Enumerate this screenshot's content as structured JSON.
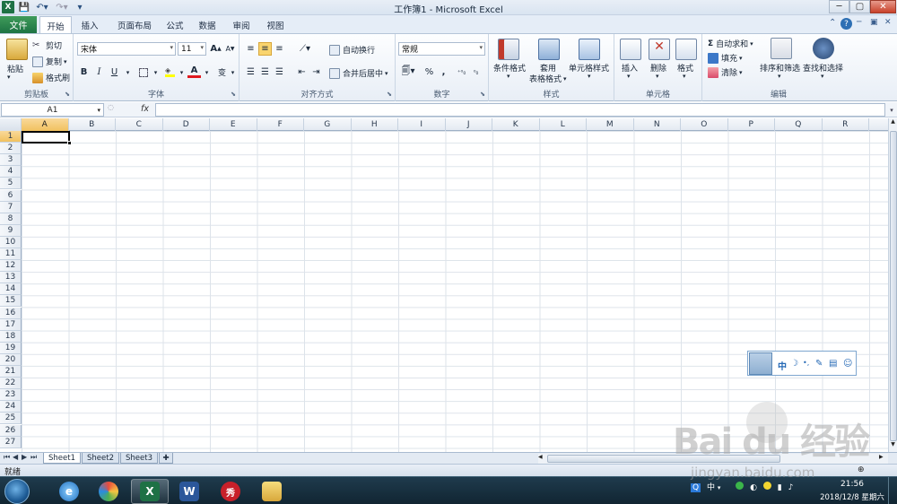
{
  "app": {
    "title": "工作簿1 - Microsoft Excel"
  },
  "tabs": [
    "文件",
    "开始",
    "插入",
    "页面布局",
    "公式",
    "数据",
    "审阅",
    "视图"
  ],
  "clipboard": {
    "paste": "粘贴",
    "cut": "剪切",
    "copy": "复制",
    "format_painter": "格式刷",
    "label": "剪贴板"
  },
  "font": {
    "name": "宋体",
    "size": "11",
    "bold": "B",
    "italic": "I",
    "underline": "U",
    "grow": "A",
    "shrink": "A",
    "font_color": "A",
    "phonetic": "变",
    "label": "字体"
  },
  "alignment": {
    "wrap": "自动换行",
    "merge": "合并后居中",
    "label": "对齐方式"
  },
  "number": {
    "format": "常规",
    "percent": "%",
    "comma": ",",
    "label": "数字"
  },
  "styles": {
    "conditional": "条件格式",
    "table_line1": "套用",
    "table_line2": "表格格式",
    "cell_styles": "单元格样式",
    "label": "样式"
  },
  "cells": {
    "insert": "插入",
    "delete": "删除",
    "format": "格式",
    "label": "单元格"
  },
  "editing": {
    "autosum": "自动求和",
    "fill": "填充",
    "clear": "清除",
    "sort": "排序和筛选",
    "find": "查找和选择",
    "label": "编辑"
  },
  "formula": {
    "namebox": "A1",
    "fx": "fx",
    "value": ""
  },
  "columns": [
    "A",
    "B",
    "C",
    "D",
    "E",
    "F",
    "G",
    "H",
    "I",
    "J",
    "K",
    "L",
    "M",
    "N",
    "O",
    "P",
    "Q",
    "R"
  ],
  "rows": [
    "1",
    "2",
    "3",
    "4",
    "5",
    "6",
    "7",
    "8",
    "9",
    "10",
    "11",
    "12",
    "13",
    "14",
    "15",
    "16",
    "17",
    "18",
    "19",
    "20",
    "21",
    "22",
    "23",
    "24",
    "25",
    "26",
    "27"
  ],
  "sheets": [
    "Sheet1",
    "Sheet2",
    "Sheet3"
  ],
  "status": {
    "text": "就绪"
  },
  "ime": {
    "mode": "中"
  },
  "tray": {
    "ime": "中"
  },
  "clock": {
    "time": "21:56",
    "date": "2018/12/8 星期六"
  },
  "watermark": {
    "logo": "Bai du 经验",
    "site": "jingyan.baidu.com"
  }
}
